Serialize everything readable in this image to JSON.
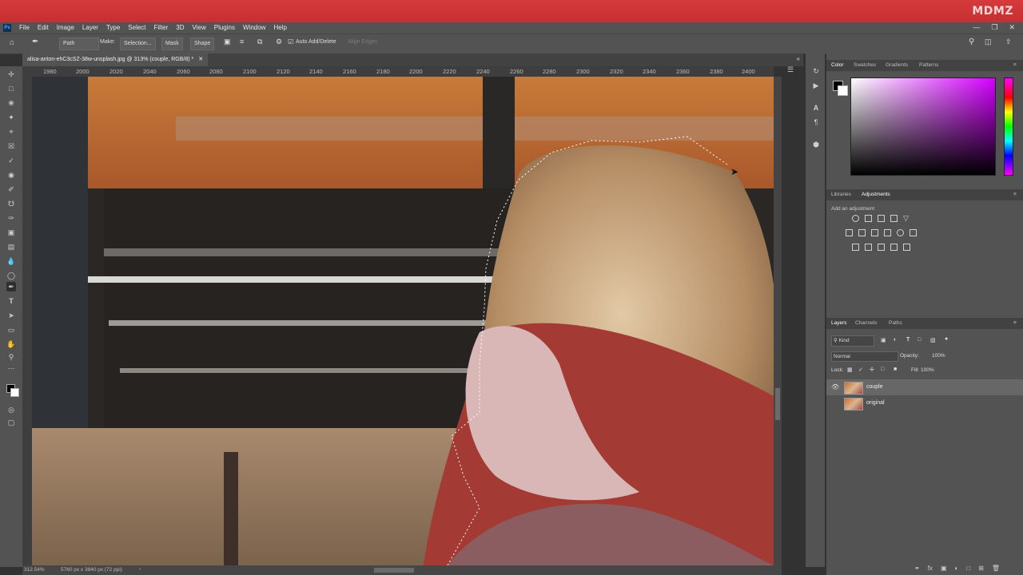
{
  "brand": "MDMZ",
  "menu": {
    "items": [
      "File",
      "Edit",
      "Image",
      "Layer",
      "Type",
      "Select",
      "Filter",
      "3D",
      "View",
      "Plugins",
      "Window",
      "Help"
    ]
  },
  "options": {
    "mode": "Path",
    "make_label": "Make:",
    "selection_btn": "Selection...",
    "mask_btn": "Mask",
    "shape_btn": "Shape",
    "auto_add_delete": "Auto Add/Delete",
    "align_edges": "Align Edges"
  },
  "document": {
    "tab_title": "alisa-anton-ehC3cSZ-38w-unsplash.jpg @ 313% (couple, RGB/8) *",
    "zoom": "312.54%",
    "dimensions": "5760 px x 3840 px (72 ppi)"
  },
  "ruler": {
    "ticks": [
      "1980",
      "2000",
      "2020",
      "2040",
      "2060",
      "2080",
      "2100",
      "2120",
      "2140",
      "2160",
      "2180",
      "2200",
      "2220",
      "2240",
      "2260",
      "2280",
      "2300",
      "2320",
      "2340",
      "2360",
      "2380",
      "2400"
    ]
  },
  "panels": {
    "color_tabs": [
      "Color",
      "Swatches",
      "Gradients",
      "Patterns"
    ],
    "adj_tabs": [
      "Libraries",
      "Adjustments"
    ],
    "add_adjustment": "Add an adjustment",
    "layers_tabs": [
      "Layers",
      "Channels",
      "Paths"
    ],
    "kind_filter": "Kind",
    "blend_mode": "Normal",
    "opacity_label": "Opacity:",
    "opacity_value": "100%",
    "lock_label": "Lock:",
    "fill_label": "Fill:",
    "fill_value": "100%",
    "layers": [
      {
        "name": "couple",
        "selected": true,
        "visible": true
      },
      {
        "name": "original",
        "selected": false,
        "visible": false
      }
    ]
  },
  "colors": {
    "title_bar": "#c62f31",
    "foreground": "#000000",
    "background": "#ffffff"
  }
}
